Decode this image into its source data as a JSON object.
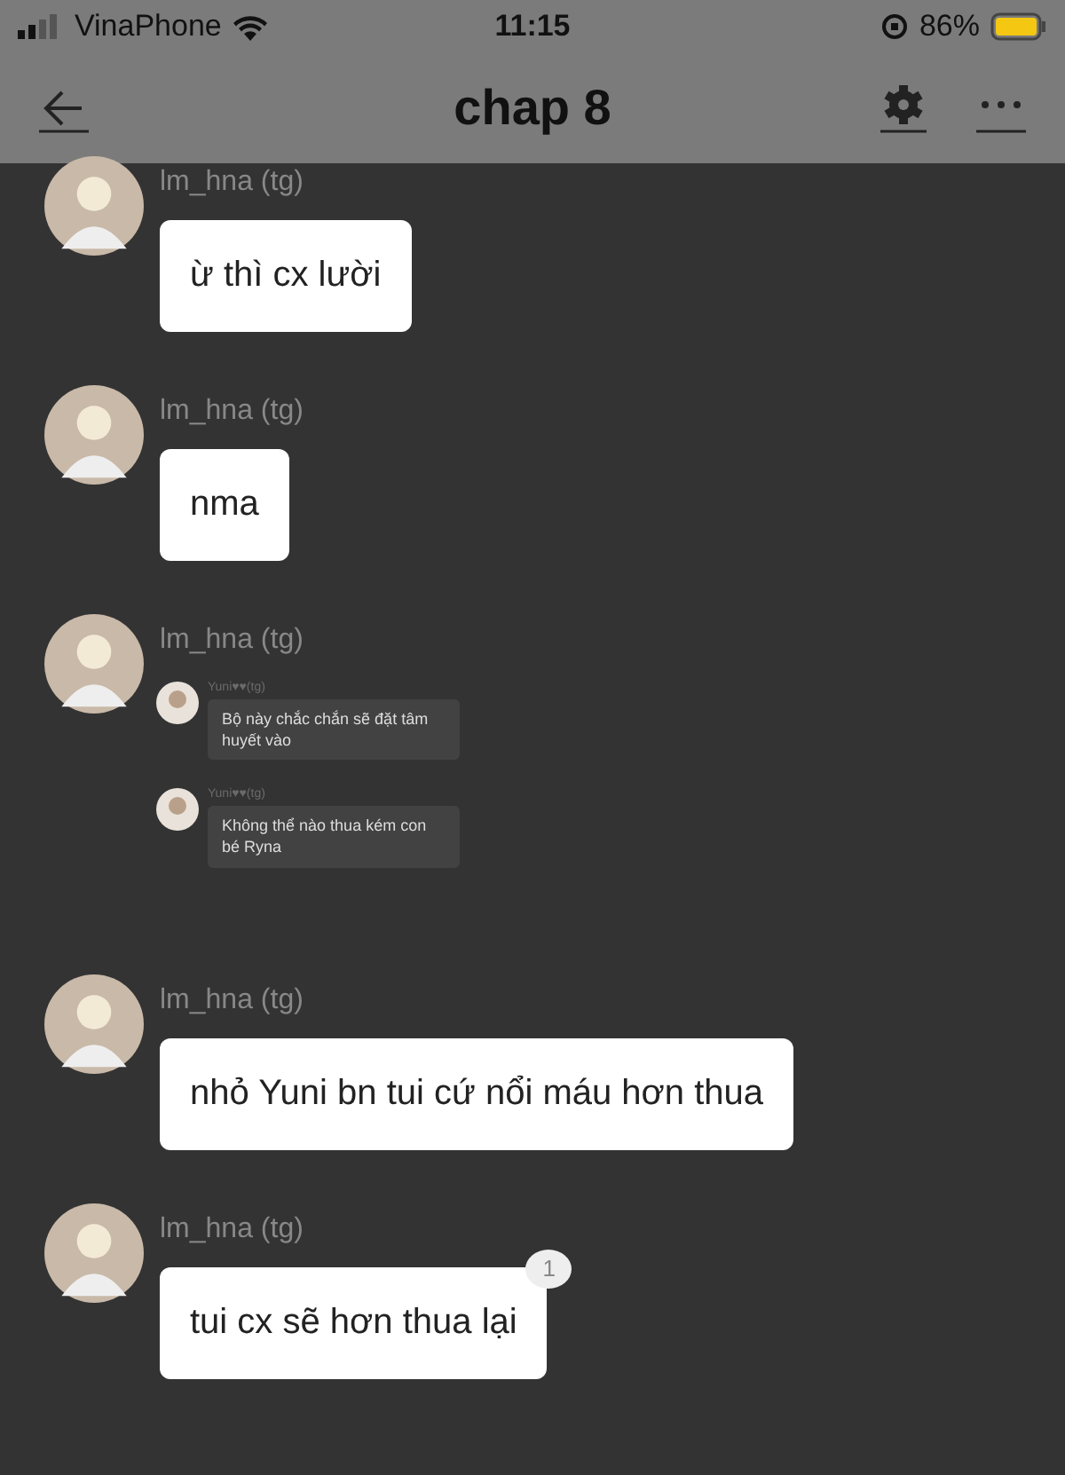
{
  "status_bar": {
    "carrier": "VinaPhone",
    "time": "11:15",
    "battery": "86%"
  },
  "header": {
    "title": "chap 8"
  },
  "messages": [
    {
      "kind": "text",
      "author": "lm_hna (tg)",
      "text": "ừ thì cx lười"
    },
    {
      "kind": "text",
      "author": "lm_hna (tg)",
      "text": "nma"
    },
    {
      "kind": "screenshot",
      "author": "lm_hna (tg)",
      "items": [
        {
          "author": "Yuni♥♥(tg)",
          "text": "Bộ này chắc chắn sẽ đặt tâm huyết vào"
        },
        {
          "author": "Yuni♥♥(tg)",
          "text": "Không thể nào thua kém con bé Ryna"
        }
      ]
    },
    {
      "kind": "text",
      "author": "lm_hna (tg)",
      "text": "nhỏ Yuni bn tui cứ nổi máu hơn thua"
    },
    {
      "kind": "text",
      "author": "lm_hna (tg)",
      "text": "tui cx sẽ hơn thua lại",
      "badge": "1"
    }
  ]
}
